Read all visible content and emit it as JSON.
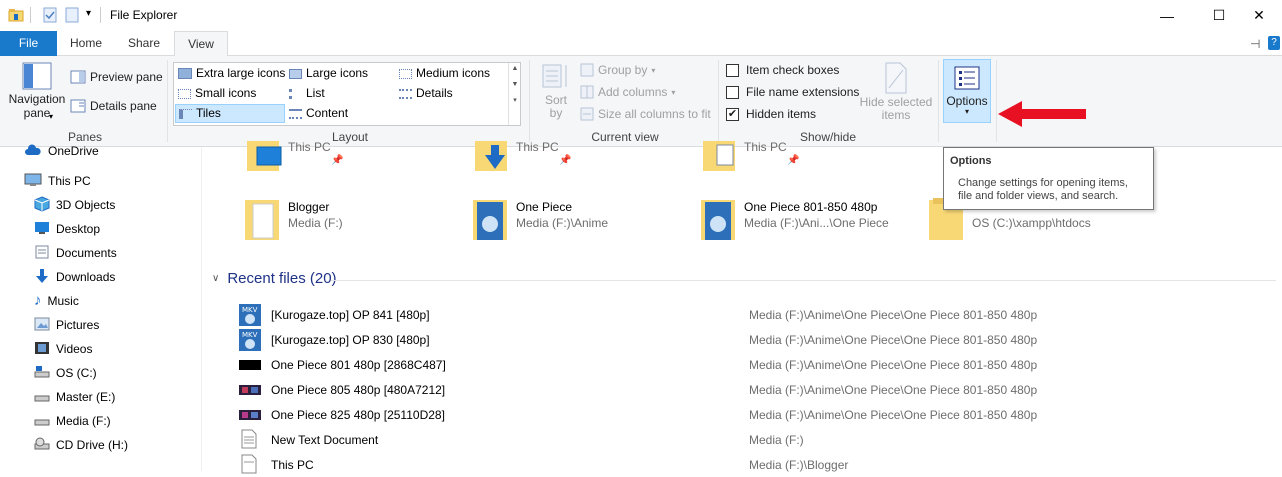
{
  "window": {
    "title": "File Explorer",
    "minimize_glyph": "—",
    "maximize_glyph": "☐",
    "close_glyph": "✕"
  },
  "tabs": [
    {
      "label": "File"
    },
    {
      "label": "Home"
    },
    {
      "label": "Share"
    },
    {
      "label": "View"
    }
  ],
  "ribbon": {
    "panes": {
      "navigation_pane": "Navigation",
      "navigation_pane2": "pane",
      "preview_pane": "Preview pane",
      "details_pane": "Details pane",
      "group_label": "Panes"
    },
    "layout": {
      "items": [
        "Extra large icons",
        "Large icons",
        "Medium icons",
        "Small icons",
        "List",
        "Details",
        "Tiles",
        "Content"
      ],
      "selected": "Tiles",
      "group_label": "Layout"
    },
    "current_view": {
      "sort_by": "Sort",
      "sort_by2": "by",
      "group_by": "Group by",
      "add_columns": "Add columns",
      "size_columns": "Size all columns to fit",
      "group_label": "Current view"
    },
    "show_hide": {
      "item_check_boxes": "Item check boxes",
      "file_name_extensions": "File name extensions",
      "hidden_items": "Hidden items",
      "hidden_items_checked": true,
      "hide_selected": "Hide selected",
      "hide_selected2": "items",
      "group_label": "Show/hide"
    },
    "options": {
      "label": "Options"
    }
  },
  "tooltip": {
    "title": "Options",
    "body_line1": "Change settings for opening items,",
    "body_line2": "file and folder views, and search."
  },
  "nav": {
    "items": [
      {
        "label": "OneDrive",
        "icon": "cloud-icon"
      },
      {
        "label": "This PC",
        "icon": "computer-icon"
      },
      {
        "label": "3D Objects",
        "icon": "cube-icon"
      },
      {
        "label": "Desktop",
        "icon": "desktop-icon"
      },
      {
        "label": "Documents",
        "icon": "documents-icon"
      },
      {
        "label": "Downloads",
        "icon": "download-arrow-icon"
      },
      {
        "label": "Music",
        "icon": "music-note-icon"
      },
      {
        "label": "Pictures",
        "icon": "pictures-icon"
      },
      {
        "label": "Videos",
        "icon": "film-icon"
      },
      {
        "label": "OS (C:)",
        "icon": "drive-icon"
      },
      {
        "label": "Master (E:)",
        "icon": "drive-icon"
      },
      {
        "label": "Media (F:)",
        "icon": "drive-icon"
      },
      {
        "label": "CD Drive (H:)",
        "icon": "cd-drive-icon"
      }
    ]
  },
  "quick_access": {
    "row1": [
      {
        "name": "",
        "path": "This PC"
      },
      {
        "name": "",
        "path": "This PC"
      },
      {
        "name": "",
        "path": "This PC"
      }
    ],
    "row2": [
      {
        "name": "Blogger",
        "path": "Media (F:)"
      },
      {
        "name": "One Piece",
        "path": "Media (F:)\\Anime"
      },
      {
        "name": "One Piece 801-850 480p",
        "path": "Media (F:)\\Ani...\\One Piece"
      },
      {
        "name": "",
        "path": "OS (C:)\\xampp\\htdocs"
      }
    ]
  },
  "recent": {
    "header": "Recent files (20)",
    "items": [
      {
        "name": "[Kurogaze.top] OP 841 [480p]",
        "path": "Media (F:)\\Anime\\One Piece\\One Piece 801-850 480p",
        "icon": "mkv-file-icon"
      },
      {
        "name": "[Kurogaze.top] OP 830 [480p]",
        "path": "Media (F:)\\Anime\\One Piece\\One Piece 801-850 480p",
        "icon": "mkv-file-icon"
      },
      {
        "name": "One Piece 801 480p [2868C487]",
        "path": "Media (F:)\\Anime\\One Piece\\One Piece 801-850 480p",
        "icon": "video-thumbnail-icon"
      },
      {
        "name": "One Piece 805 480p [480A7212]",
        "path": "Media (F:)\\Anime\\One Piece\\One Piece 801-850 480p",
        "icon": "video-thumbnail-icon"
      },
      {
        "name": "One Piece 825 480p [25110D28]",
        "path": "Media (F:)\\Anime\\One Piece\\One Piece 801-850 480p",
        "icon": "video-thumbnail-icon"
      },
      {
        "name": "New Text Document",
        "path": "Media (F:)",
        "icon": "text-file-icon"
      },
      {
        "name": "This PC",
        "path": "Media (F:)\\Blogger",
        "icon": "text-file-icon"
      }
    ]
  },
  "colors": {
    "file_tab": "#1979ca",
    "accent_blue": "#1e3287",
    "arrow_red": "#e81123",
    "folder_yellow": "#f8d775"
  }
}
